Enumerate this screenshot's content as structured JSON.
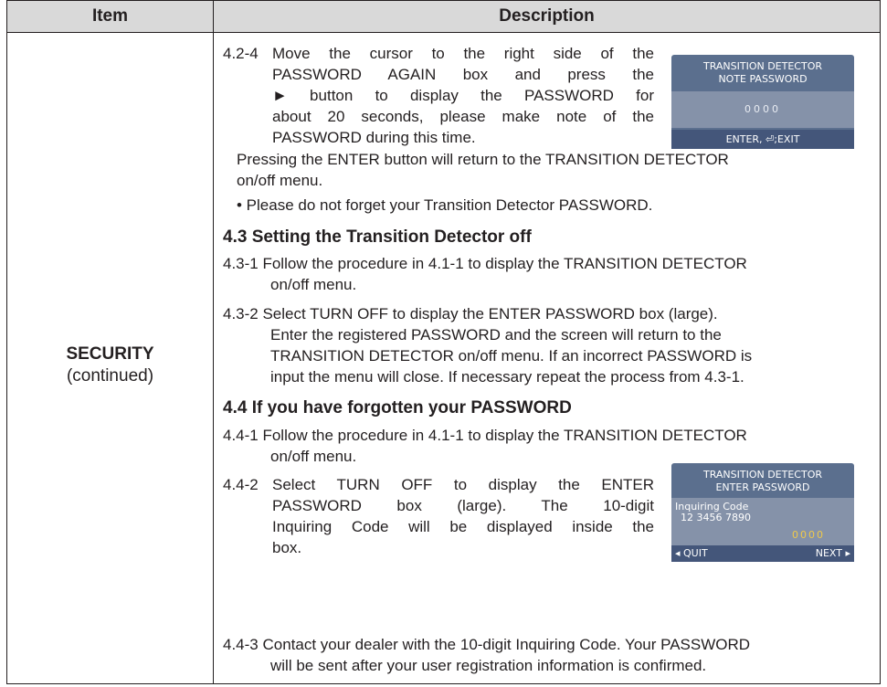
{
  "header": {
    "item": "Item",
    "description": "Description"
  },
  "item": {
    "title": "SECURITY",
    "subtitle": "(continued)"
  },
  "p424": {
    "num": "4.2-4",
    "l1": "Move the cursor to the right side of the",
    "l2": "PASSWORD AGAIN box and press the",
    "l3": "► button to display the PASSWORD for",
    "l4": "about 20 seconds, please make note of the",
    "l5": "PASSWORD during this time."
  },
  "pressing": {
    "l1": "Pressing the ENTER button will return to the TRANSITION DETECTOR",
    "l2": "on/off menu."
  },
  "bullet": "• Please do not forget your Transition Detector PASSWORD.",
  "h43": "4.3 Setting the Transition Detector off",
  "p431": {
    "l1": "4.3-1 Follow the procedure in 4.1-1 to display the TRANSITION DETECTOR",
    "l2": "on/off menu."
  },
  "p432": {
    "l1": "4.3-2 Select TURN OFF to display the ENTER PASSWORD box (large).",
    "l2": "Enter the registered PASSWORD and the screen will return to the",
    "l3": "TRANSITION DETECTOR on/off menu. If an incorrect PASSWORD is",
    "l4": "input the menu will close. If necessary repeat the process from 4.3-1."
  },
  "h44": "4.4 If you have forgotten your PASSWORD",
  "p441": {
    "l1": "4.4-1 Follow the procedure in 4.1-1 to display the TRANSITION DETECTOR",
    "l2": "on/off menu."
  },
  "p442": {
    "num": "4.4-2",
    "l1": "Select TURN OFF to display the ENTER",
    "l2": "PASSWORD box (large). The 10-digit",
    "l3": "Inquiring Code will be displayed inside the",
    "l4": "box."
  },
  "p443": {
    "l1": "4.4-3 Contact your dealer with the 10-digit Inquiring Code. Your PASSWORD",
    "l2": "will be sent after your user registration information is confirmed."
  },
  "osd1": {
    "line1": "TRANSITION DETECTOR",
    "line2": "NOTE PASSWORD",
    "code": "0000",
    "footer": "ENTER, ⏎;EXIT"
  },
  "osd2": {
    "line1": "TRANSITION DETECTOR",
    "line2": "ENTER PASSWORD",
    "inquiring_label": "Inquiring Code",
    "inquiring_value": "12 3456 7890",
    "entry": "0000",
    "quit": "◂ QUIT",
    "next": "NEXT ▸"
  }
}
